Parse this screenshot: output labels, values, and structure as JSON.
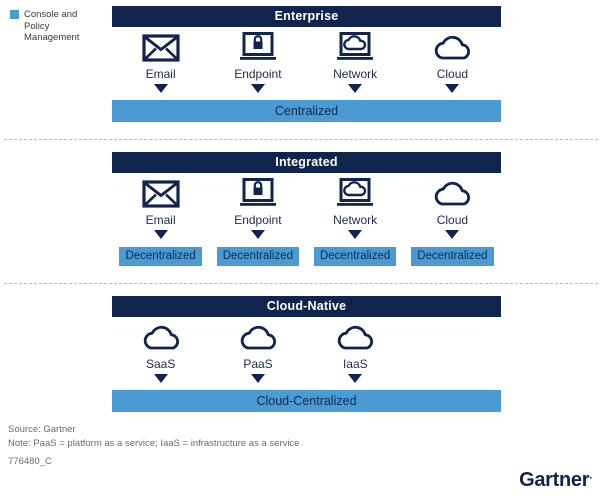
{
  "legend": {
    "icon": "square-swatch-icon",
    "color": "#4a9ad4",
    "label": "Console and Policy Management"
  },
  "colors": {
    "header_navy": "#11244e",
    "accent_blue": "#4a9ad4",
    "text_navy": "#122a52",
    "footnote_gray": "#6b6b6b"
  },
  "sections": [
    {
      "id": "enterprise",
      "title": "Enterprise",
      "items": [
        {
          "icon": "envelope-icon",
          "label": "Email"
        },
        {
          "icon": "laptop-lock-icon",
          "label": "Endpoint"
        },
        {
          "icon": "laptop-cloud-icon",
          "label": "Network"
        },
        {
          "icon": "cloud-icon",
          "label": "Cloud"
        }
      ],
      "result_type": "bar",
      "result_label": "Centralized"
    },
    {
      "id": "integrated",
      "title": "Integrated",
      "items": [
        {
          "icon": "envelope-icon",
          "label": "Email"
        },
        {
          "icon": "laptop-lock-icon",
          "label": "Endpoint"
        },
        {
          "icon": "laptop-cloud-icon",
          "label": "Network"
        },
        {
          "icon": "cloud-icon",
          "label": "Cloud"
        }
      ],
      "result_type": "chips",
      "chips": [
        "Decentralized",
        "Decentralized",
        "Decentralized",
        "Decentralized"
      ]
    },
    {
      "id": "cloud-native",
      "title": "Cloud-Native",
      "items": [
        {
          "icon": "cloud-icon",
          "label": "SaaS"
        },
        {
          "icon": "cloud-icon",
          "label": "PaaS"
        },
        {
          "icon": "cloud-icon",
          "label": "IaaS"
        }
      ],
      "result_type": "bar",
      "result_label": "Cloud-Centralized"
    }
  ],
  "footer": {
    "source": "Source: Gartner",
    "note": "Note: PaaS = platform as a service; IaaS = infrastructure as a service",
    "code": "776480_C",
    "logo": "Gartner"
  }
}
